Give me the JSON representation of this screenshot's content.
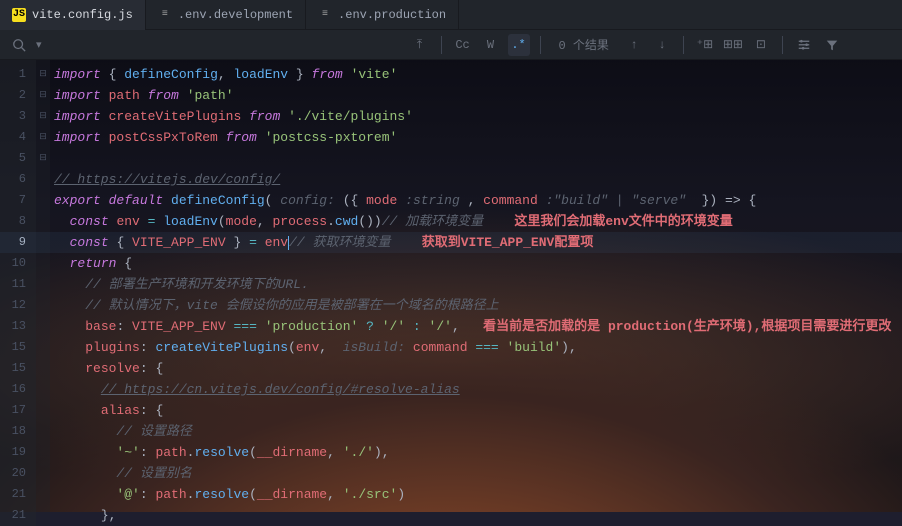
{
  "tabs": [
    {
      "icon": "JS",
      "label": "vite.config.js",
      "active": true
    },
    {
      "icon": "≡",
      "label": ".env.development",
      "active": false
    },
    {
      "icon": "≡",
      "label": ".env.production",
      "active": false
    }
  ],
  "search": {
    "placeholder": "",
    "cc": "Cc",
    "w": "W",
    "regex": ".*",
    "results": "0 个结果"
  },
  "annotations": {
    "a1": "这里我们会加载env文件中的环境变量",
    "a2": "获取到VITE_APP_ENV配置项",
    "a3": "看当前是否加载的是 production(生产环境),根据项目需要进行更改"
  },
  "code": {
    "l1": {
      "import": "import",
      "lb": "{",
      "defineConfig": "defineConfig",
      "comma": ", ",
      "loadEnv": "loadEnv",
      "rb": "}",
      "from": "from",
      "vite": "'vite'"
    },
    "l2": {
      "import": "import",
      "path": "path",
      "from": "from",
      "str": "'path'"
    },
    "l3": {
      "import": "import",
      "cvp": "createVitePlugins",
      "from": "from",
      "str": "'./vite/plugins'"
    },
    "l4": {
      "import": "import",
      "pcr": "postCssPxToRem",
      "from": "from",
      "str": "'postcss-pxtorem'"
    },
    "l6": {
      "cm": "// https://vitejs.dev/config/"
    },
    "l7": {
      "export": "export",
      "default": "default",
      "dc": "defineConfig",
      "config": "config:",
      "lb": "({",
      "mode": "mode",
      "str1": " :string ",
      "comma": ", ",
      "command": "command",
      "str2": " :\"build\" | \"serve\" ",
      "rb": "}) =>",
      "ob": "{"
    },
    "l8": {
      "const": "const",
      "env": "env",
      "eq": " = ",
      "loadEnv": "loadEnv",
      "lp": "(",
      "mode": "mode",
      "comma": ", ",
      "process": "process",
      "dot": ".",
      "cwd": "cwd",
      "rp": "())",
      "cm": "// 加载环境变量"
    },
    "l9": {
      "const": "const",
      "lb": "{ ",
      "vae": "VITE_APP_ENV",
      "rb": " }",
      "eq": " = ",
      "env": "env",
      "cm": "// 获取环境变量"
    },
    "l10": {
      "return": "return",
      "ob": "{"
    },
    "l11": {
      "cm": "// 部署生产环境和开发环境下的URL."
    },
    "l12": {
      "cm": "// 默认情况下，vite 会假设你的应用是被部署在一个域名的根路径上"
    },
    "l13": {
      "base": "base",
      "col": ": ",
      "vae": "VITE_APP_ENV",
      "eqq": " === ",
      "prod": "'production'",
      "q": " ? ",
      "s1": "'/'",
      "c2": " : ",
      "s2": "'/'",
      "comma": ","
    },
    "l14": {
      "plugins": "plugins",
      "col": ": ",
      "cvp": "createVitePlugins",
      "lp": "(",
      "env": "env",
      "comma": ",  ",
      "isBuild": "isBuild:",
      "sp": " ",
      "command": "command",
      "eqq": " === ",
      "build": "'build'",
      "rp": "),"
    },
    "l15": {
      "resolve": "resolve",
      "col": ": ",
      "ob": "{"
    },
    "l16": {
      "cm": "// https://cn.vitejs.dev/config/#resolve-alias"
    },
    "l17": {
      "alias": "alias",
      "col": ": ",
      "ob": "{"
    },
    "l18": {
      "cm": "// 设置路径"
    },
    "l19": {
      "tilde": "'~'",
      "col": ": ",
      "path": "path",
      "dot": ".",
      "resolve": "resolve",
      "lp": "(",
      "dirname": "__dirname",
      "comma": ", ",
      "s": "'./'",
      "rp": "),"
    },
    "l20": {
      "cm": "// 设置别名"
    },
    "l21": {
      "at": "'@'",
      "col": ": ",
      "path": "path",
      "dot": ".",
      "resolve": "resolve",
      "lp": "(",
      "dirname": "__dirname",
      "comma": ", ",
      "s": "'./src'",
      "rp": ")"
    },
    "l22": {
      "rb": "},"
    }
  },
  "lineNumbers": [
    "1",
    "2",
    "3",
    "4",
    "5",
    "6",
    "7",
    "8",
    "9",
    "10",
    "11",
    "12",
    "13",
    "15",
    "15",
    "16",
    "17",
    "18",
    "19",
    "20",
    "21",
    "21"
  ]
}
